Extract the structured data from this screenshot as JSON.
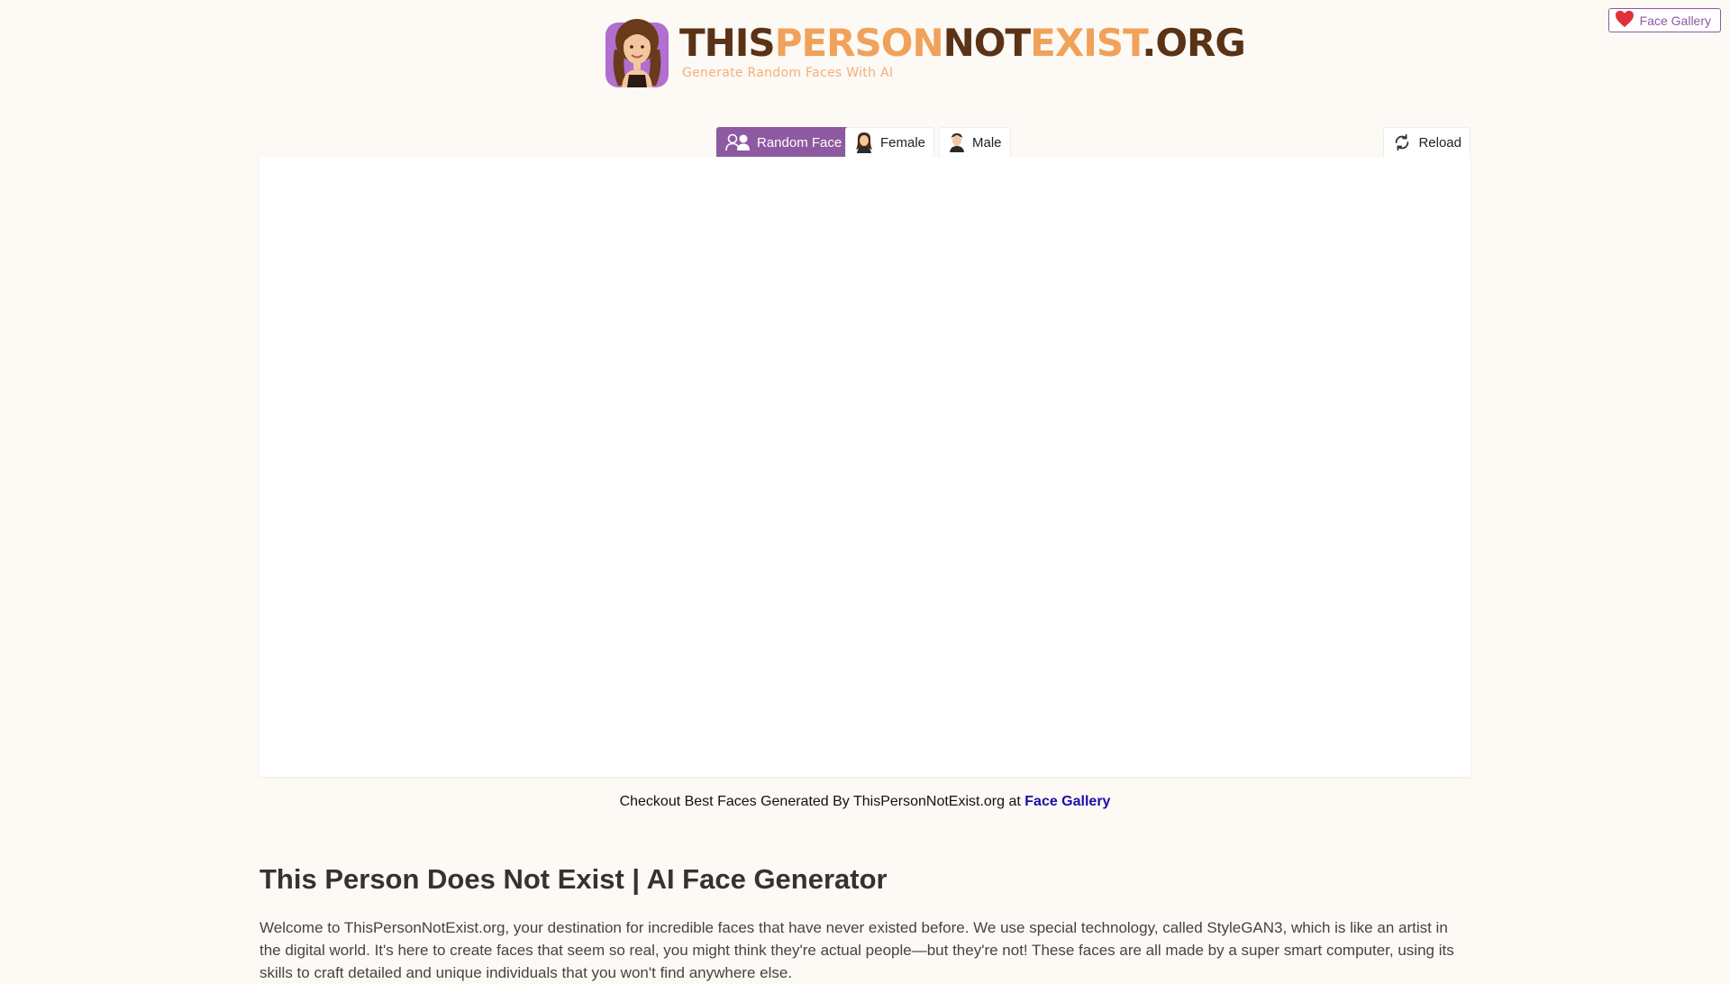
{
  "header": {
    "gallery_button": "Face Gallery",
    "logo": {
      "title_parts": [
        "THIS",
        "PERSON",
        "NOT",
        "EXIST",
        ".ORG"
      ],
      "subtitle": "Generate Random Faces With AI"
    }
  },
  "tabs": {
    "random": "Random Face",
    "female": "Female",
    "male": "Male",
    "reload": "Reload"
  },
  "checkout": {
    "text": "Checkout Best Faces Generated By ThisPersonNotExist.org at ",
    "link": "Face Gallery"
  },
  "article": {
    "heading": "This Person Does Not Exist | AI Face Generator",
    "intro": "Welcome to ThisPersonNotExist.org, your destination for incredible faces that have never existed before. We use special technology, called StyleGAN3, which is like an artist in the digital world. It's here to create faces that seem so real, you might think they're actual people—but they're not! These faces are all made by a super smart computer, using its skills to craft detailed and unique individuals that you won't find anywhere else."
  },
  "colors": {
    "accent": "#8d5aa1",
    "background": "#fdf9f4",
    "logo_dark": "#5a3216",
    "logo_orange": "#f0a25b",
    "link": "#1a0dab",
    "heart": "#e0303a"
  },
  "icons": {
    "gallery": "heart-icon",
    "random": "people-pair-icon",
    "female": "female-icon",
    "male": "male-icon",
    "reload": "reload-icon"
  }
}
